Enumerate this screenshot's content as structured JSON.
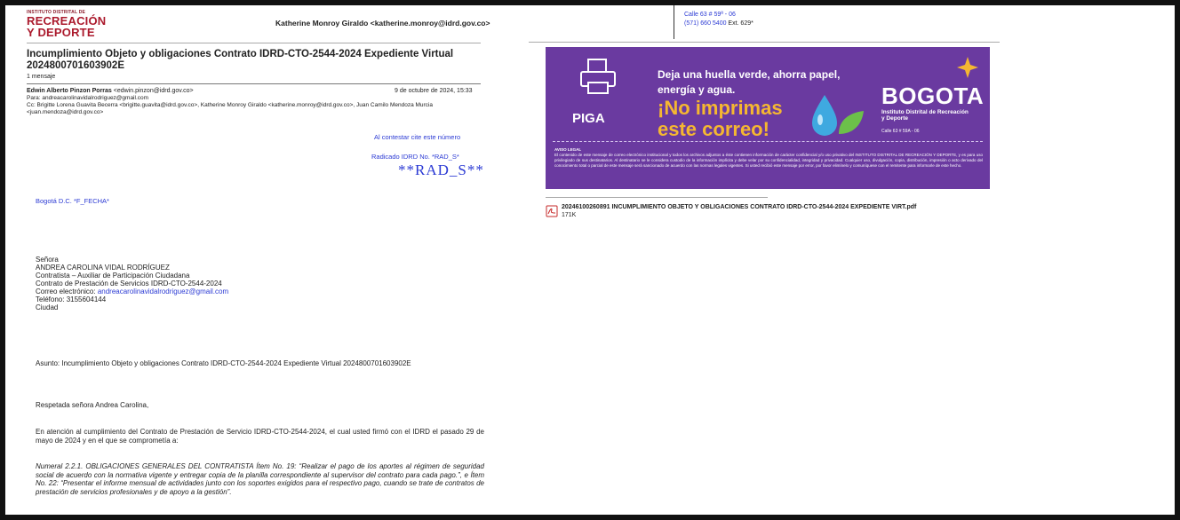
{
  "logo": {
    "line1": "INSTITUTO DISTRITAL DE",
    "line2": "RECREACIÓN",
    "line3": "Y DEPORTE"
  },
  "header": {
    "from": "Katherine Monroy Giraldo <katherine.monroy@idrd.gov.co>"
  },
  "email": {
    "subject": "Incumplimiento Objeto y obligaciones Contrato IDRD-CTO-2544-2024 Expediente Virtual 2024800701603902E",
    "count": "1 mensaje",
    "sender_name": "Edwin Alberto Pinzon Porras",
    "sender_email": "<edwin.pinzon@idrd.gov.co>",
    "date": "9 de octubre de 2024, 15:33",
    "to": "Para: andreacarolinavidalrodriguez@gmail.com",
    "cc": "Cc: Brigitte Lorena Guavita Becerra <brigitte.guavita@idrd.gov.co>, Katherine Monroy Giraldo <katherine.monroy@idrd.gov.co>, Juan Camilo Mendoza Murcia <juan.mendoza@idrd.gov.co>"
  },
  "letter": {
    "cite": "Al contestar cite este número",
    "radicado": "Radicado IDRD No. *RAD_S*",
    "rad_big": "**RAD_S**",
    "place_date": "Bogotá D.C. *F_FECHA*",
    "recipient": {
      "title": "Señora",
      "name": "ANDREA CAROLINA VIDAL RODRÍGUEZ",
      "role": "Contratista – Auxiliar de Participación Ciudadana",
      "contract": "Contrato de Prestación de Servicios IDRD-CTO-2544-2024",
      "email_label": "Correo electrónico: ",
      "email": "andreacarolinavidalrodriguez@gmail.com",
      "phone": "Teléfono: 3155604144",
      "city": "Ciudad"
    },
    "asunto": "Asunto: Incumplimiento Objeto y obligaciones Contrato IDRD-CTO-2544-2024 Expediente Virtual 2024800701603902E",
    "saludo": "Respetada señora Andrea Carolina,",
    "p1": "En atención al cumplimiento del Contrato de Prestación de Servicio IDRD-CTO-2544-2024, el cual usted firmó con el IDRD el pasado 29 de mayo de 2024 y en el que se comprometía a:",
    "p2": "Numeral 2.2.1. OBLIGACIONES GENERALES DEL CONTRATISTA Ítem No. 19: “Realizar el pago de los aportes al régimen de seguridad social de acuerdo con la normativa vigente y entregar copia de la planilla correspondiente al supervisor del contrato para cada pago.”, e Ítem No. 22: “Presentar el informe mensual de actividades junto con los soportes exigidos para el respectivo pago, cuando se trate de contratos de prestación de servicios profesionales y de apoyo a la gestión”."
  },
  "right": {
    "address_line": "Calle 63 # 59ª - 06",
    "phone_line": "(571) 660 5400",
    "ext": " Ext. 629*"
  },
  "banner": {
    "line1": "Deja una huella verde, ahorra papel,",
    "line2": "energía y agua.",
    "line3": "¡No imprimas",
    "line4": "este correo!",
    "piga": "PIGA",
    "brand": "BOGOTA",
    "brand_sub": "Instituto Distrital de Recreación y Deporte",
    "brand_addr": "Calle 63 # 59A - 06",
    "aviso_title": "AVISO LEGAL",
    "aviso_text": "El contenido de este mensaje de correo electrónico institucional y todos los archivos adjuntos a éste contienen información de carácter confidencial y/o uso privativo del INSTITUTO DISTRITAL DE RECREACIÓN Y DEPORTE, y es para uso privilegiado de sus destinatarios. Al destinatario se le considera custodio de la información implícita y debe velar por su confidencialidad, integridad y privacidad. Cualquier uso, divulgación, copia, distribución, impresión o acto derivado del conocimiento total o parcial de este mensaje será sancionado de acuerdo con las normas legales vigentes. Si usted recibió este mensaje por error, por favor elimínelo y comuníquese con el remitente para informarle de este hecho.",
    "colors": {
      "bg": "#6a3aa0",
      "accent": "#f5b731"
    }
  },
  "attachment": {
    "icon": "pdf-icon",
    "name": "20246100260891 INCUMPLIMIENTO OBJETO Y OBLIGACIONES CONTRATO IDRD-CTO-2544-2024 EXPEDIENTE VIRT.pdf",
    "size": "171K"
  }
}
